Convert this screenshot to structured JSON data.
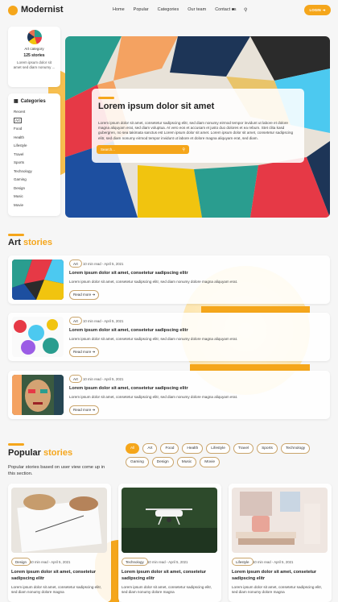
{
  "nav": {
    "logo": "Modernist",
    "links": [
      "Home",
      "Popular",
      "Categories",
      "Our team",
      "Contact us"
    ],
    "login": "LOGIN",
    "icons": [
      "moon-icon",
      "search-icon",
      "login-arrow-icon"
    ]
  },
  "sidebar": {
    "category_label": "Art category",
    "count": "125 stories",
    "desc": "Lorem ipsum dolor sit amet sed diam nonumy ...",
    "list_title": "Categories",
    "items": [
      "Recent",
      "Art",
      "Food",
      "Health",
      "Lifestyle",
      "Travel",
      "Sports",
      "Technology",
      "Gaming",
      "Design",
      "Music",
      "Movie"
    ],
    "active": "Art"
  },
  "hero": {
    "title": "Lorem ipsum dolor sit amet",
    "text": "Lorem ipsum dolor sit amet, consetetur sadipscing elitr, sed diam nonumy eirmod tempor invidunt ut labore et dolore magna aliquyam erat, sed diam voluptua. At vero eos et accusam et justo duo dolores et ea rebum. Stet clita kasd gubergren, no sea takimata sanctus est Lorem ipsum dolor sit amet. Lorem ipsum dolor sit amet, consetetur sadipscing elitr, sed diam nonumy eirmod tempor invidunt ut labore et dolore magna aliquyam erat, sed diam.",
    "search_placeholder": "Search..."
  },
  "art_section": {
    "title_a": "Art",
    "title_b": " stories",
    "stories": [
      {
        "tag": "Art",
        "meta": "10 min read - April 5, 2021",
        "title": "Lorem ipsum dolor sit amet, consetetur sadipscing elitr",
        "desc": "Lorem ipsum dolor sit amet, consetetur sadipscing elitr, sed diam nonumy dolore magna aliquyam erat.",
        "button": "Read more"
      },
      {
        "tag": "Art",
        "meta": "10 min read - April 5, 2021",
        "title": "Lorem ipsum dolor sit amet, consetetur sadipscing elitr",
        "desc": "Lorem ipsum dolor sit amet, consetetur sadipscing elitr, sed diam nonumy dolore magna aliquyam erat.",
        "button": "Read more"
      },
      {
        "tag": "Art",
        "meta": "10 min read - April 5, 2021",
        "title": "Lorem ipsum dolor sit amet, consetetur sadipscing elitr",
        "desc": "Lorem ipsum dolor sit amet, consetetur sadipscing elitr, sed diam nonumy dolore magna aliquyam erat.",
        "button": "Read more"
      }
    ]
  },
  "popular": {
    "title_a": "Popular",
    "title_b": " stories",
    "desc": "Popular stories based on user view come up in this section.",
    "filters": [
      "All",
      "Art",
      "Food",
      "Health",
      "Lifestyle",
      "Travel",
      "Sports",
      "Technology",
      "Gaming",
      "Design",
      "Music",
      "Movie"
    ],
    "active_filter": "All",
    "cards": [
      {
        "tag": "Design",
        "meta": "10 min read - April 5, 2021",
        "title": "Lorem ipsum dolor sit amet, consetetur sadipscing elitr",
        "desc": "Lorem ipsum dolor sit amet, consetetur sadipscing elitr, sed diam nonumy dolore magna"
      },
      {
        "tag": "Technology",
        "meta": "10 min read - April 5, 2021",
        "title": "Lorem ipsum dolor sit amet, consetetur sadipscing elitr",
        "desc": "Lorem ipsum dolor sit amet, consetetur sadipscing elitr, sed diam nonumy dolore magna"
      },
      {
        "tag": "Lifestyle",
        "meta": "10 min read - April 5, 2021",
        "title": "Lorem ipsum dolor sit amet, consetetur sadipscing elitr",
        "desc": "Lorem ipsum dolor sit amet, consetetur sadipscing elitr, sed diam nonumy dolore magna"
      }
    ]
  },
  "colors": {
    "accent": "#f5a61b",
    "text": "#222222",
    "background": "#f6f6f6"
  }
}
